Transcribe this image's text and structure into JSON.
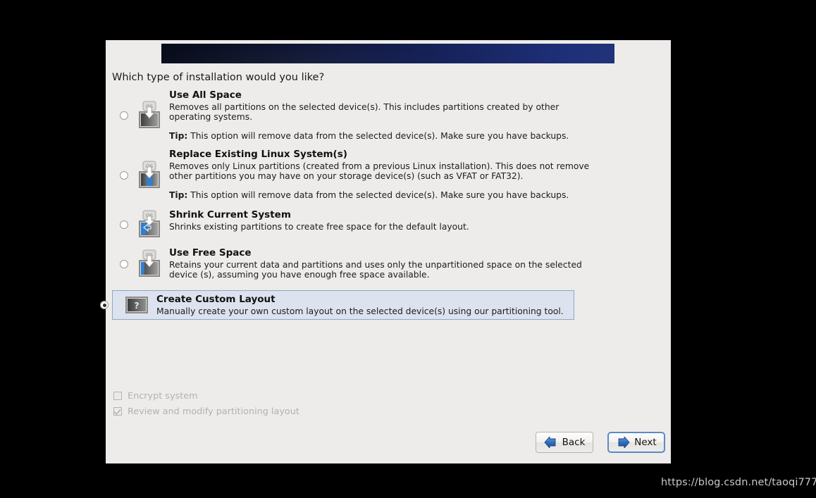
{
  "window": {
    "background_color": "#000000",
    "dialog_color": "#edecea"
  },
  "banner": {
    "gradient_from": "#080c1a",
    "gradient_to": "#203379"
  },
  "prompt": "Which type of installation would you like?",
  "options": [
    {
      "title": "Use All Space",
      "description": "Removes all partitions on the selected device(s).  This includes partitions created by other operating systems.",
      "tip_label": "Tip:",
      "tip_text": "This option will remove data from the selected device(s).  Make sure you have backups.",
      "icon": "disk-use-all-space-icon",
      "selected": false
    },
    {
      "title": "Replace Existing Linux System(s)",
      "description": "Removes only Linux partitions (created from a previous Linux installation).  This does not remove other partitions you may have on your storage device(s) (such as VFAT or FAT32).",
      "tip_label": "Tip:",
      "tip_text": "This option will remove data from the selected device(s).  Make sure you have backups.",
      "icon": "disk-replace-linux-icon",
      "selected": false
    },
    {
      "title": "Shrink Current System",
      "description": "Shrinks existing partitions to create free space for the default layout.",
      "tip_label": "",
      "tip_text": "",
      "icon": "disk-shrink-icon",
      "selected": false
    },
    {
      "title": "Use Free Space",
      "description": "Retains your current data and partitions and uses only the unpartitioned space on the selected device (s), assuming you have enough free space available.",
      "tip_label": "",
      "tip_text": "",
      "icon": "disk-free-space-icon",
      "selected": false
    },
    {
      "title": "Create Custom Layout",
      "description": "Manually create your own custom layout on the selected device(s) using our partitioning tool.",
      "tip_label": "",
      "tip_text": "",
      "icon": "disk-custom-layout-icon",
      "selected": true
    }
  ],
  "checkboxes": [
    {
      "label": "Encrypt system",
      "checked": false,
      "disabled": true
    },
    {
      "label": "Review and modify partitioning layout",
      "checked": true,
      "disabled": true
    }
  ],
  "buttons": {
    "back": "Back",
    "next": "Next"
  },
  "watermark": "https://blog.csdn.net/taoqi777",
  "colors": {
    "selection_background": "#dce3ef",
    "selection_border": "#8fa7c4",
    "focus_border": "#5b8ac4",
    "arrow_blue": "#2f6fc0",
    "disabled_text": "#b3b2af"
  }
}
